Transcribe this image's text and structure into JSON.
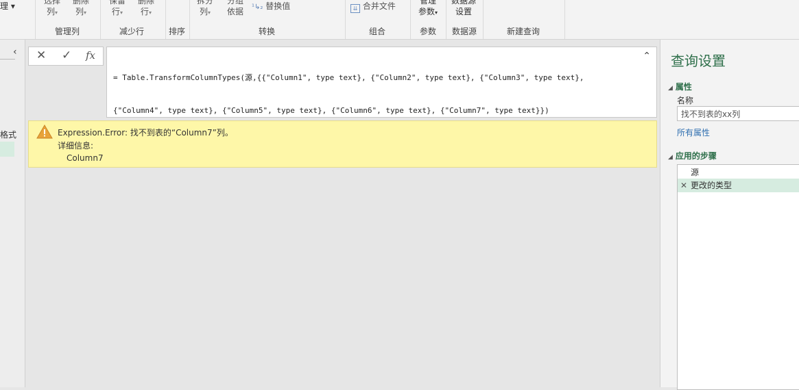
{
  "ribbon": {
    "partial_top_label": "理 ▾",
    "buttons": [
      {
        "line1": "选择",
        "line2": "列"
      },
      {
        "line1": "删除",
        "line2": "列"
      },
      {
        "line1": "保留",
        "line2": "行"
      },
      {
        "line1": "删除",
        "line2": "行"
      },
      {
        "line1": "拆分",
        "line2": "列"
      },
      {
        "line1": "分组",
        "line2": "依据"
      },
      {
        "line1": "管理",
        "line2": "参数"
      },
      {
        "line1": "数据源",
        "line2": "设置"
      }
    ],
    "replace_values": "替换值",
    "merge_files": "合并文件",
    "groups": {
      "manage_columns": "管理列",
      "reduce_rows": "减少行",
      "sort": "排序",
      "transform": "转换",
      "combine": "组合",
      "parameters": "参数",
      "data_sources": "数据源",
      "new_query": "新建查询"
    }
  },
  "left_nav": {
    "partial_text": "格式"
  },
  "formula_bar": {
    "fx_label": "fx",
    "line1": "= Table.TransformColumnTypes(源,{{\"Column1\", type text}, {\"Column2\", type text}, {\"Column3\", type text},",
    "line2": "{\"Column4\", type text}, {\"Column5\", type text}, {\"Column6\", type text}, {\"Column7\", type text}})"
  },
  "error": {
    "message": "Expression.Error: 找不到表的“Column7”列。",
    "details_label": "详细信息:",
    "detail_value": "Column7"
  },
  "query_settings": {
    "title": "查询设置",
    "properties_header": "属性",
    "name_label": "名称",
    "name_value": "找不到表的xx列",
    "all_properties_link": "所有属性",
    "steps_header": "应用的步骤",
    "steps": [
      {
        "label": "源",
        "selected": false
      },
      {
        "label": "更改的类型",
        "selected": true
      }
    ]
  },
  "colors": {
    "accent_green": "#2e6f4a",
    "error_bg": "#fef7a8",
    "selected_step": "#d6ece0",
    "link_blue": "#2f6fb0"
  }
}
